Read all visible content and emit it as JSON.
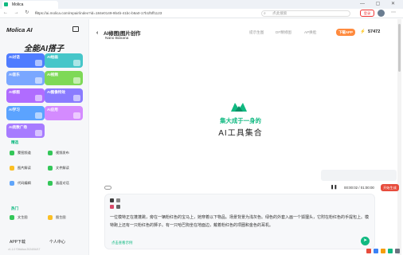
{
  "browser": {
    "tab_title": "Molica",
    "url": "https://ai.molica.com/repair/index?id=184e0149-9b4b-41bc-b6a0-17b1f5ff1123",
    "search_placeholder": "点此搜索",
    "addr_button": "登录",
    "nav_icons": "← → ↻ ⌂",
    "window_controls": "— ▢ ✕"
  },
  "sidebar": {
    "logo": "Molica AI",
    "slogan": "全能AI搭子",
    "tiles": [
      {
        "label": "AI对话",
        "color": "#4f7cff"
      },
      {
        "label": "AI绘画",
        "color": "#46c6c9"
      },
      {
        "label": "AI音乐",
        "color": "#7aa7ff"
      },
      {
        "label": "AI视频",
        "color": "#7ed957"
      },
      {
        "label": "AI修图",
        "color": "#b06cff"
      },
      {
        "label": "AI图像特效",
        "color": "#8a7bff"
      },
      {
        "label": "AI学习",
        "color": "#5ba3ff"
      },
      {
        "label": "AI应用",
        "color": "#d48bff"
      },
      {
        "label": "AI类数广场",
        "color": "#a77bff"
      }
    ],
    "group1_title": "精选",
    "group1_items": [
      {
        "label": "蒙图频道",
        "color": "#34c759"
      },
      {
        "label": "视频发布",
        "color": "#34c759"
      },
      {
        "label": "图片解读",
        "color": "#fbbf24"
      },
      {
        "label": "文件解读",
        "color": "#34c759"
      },
      {
        "label": "代码编辑",
        "color": "#60a5fa"
      },
      {
        "label": "画面对话",
        "color": "#34c759"
      }
    ],
    "group2_title": "热门",
    "group2_items": [
      {
        "label": "文生图",
        "color": "#34c759"
      },
      {
        "label": "图生图",
        "color": "#fbbf24"
      }
    ],
    "bottom_app": "APP下载",
    "bottom_me": "个人中心",
    "version": "v1.1.0 ©Molica 2024/04/17"
  },
  "header": {
    "title": "AI修图|图片创作",
    "subtitle": "Nano Banana",
    "nav": [
      "提示生图",
      "DF精修图",
      "AP换脸"
    ],
    "download": "下载APP",
    "credits": "57472"
  },
  "hero": {
    "line1": "集大成于一身的",
    "line2": "AI工具集合"
  },
  "player": {
    "time": "00:00:02 / 01:00:00",
    "generate": "开始生成"
  },
  "prompt": {
    "text": "一位模特正在蓬蓬跳，旁在一辆粉红色的宝马上，她穿着以下物品。场景背景为浅灰色。绿色的外套入画一个狐狸头，它附在粉红色的手提包上。模特跑上还有一只粉红色的狮子。有一只哈巴狗坐在地面边，戴着粉红色的项圈和金色的耳机。",
    "hint": "点击查看示例"
  },
  "colors": {
    "accent": "#10b981",
    "alert": "#e74c3c",
    "orange": "#ff8a3d"
  }
}
